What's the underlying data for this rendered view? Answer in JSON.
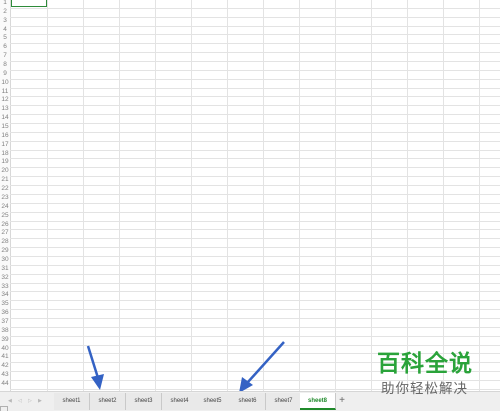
{
  "spreadsheet": {
    "row_numbers": [
      "1",
      "2",
      "3",
      "4",
      "5",
      "6",
      "7",
      "8",
      "9",
      "10",
      "11",
      "12",
      "13",
      "14",
      "15",
      "16",
      "17",
      "18",
      "19",
      "20",
      "21",
      "22",
      "23",
      "24",
      "25",
      "26",
      "27",
      "28",
      "29",
      "30",
      "31",
      "32",
      "33",
      "34",
      "35",
      "36",
      "37",
      "38",
      "39",
      "40",
      "41",
      "42",
      "43",
      "44"
    ]
  },
  "sheet_tabs": [
    {
      "label": "sheet1",
      "active": false
    },
    {
      "label": "sheet2",
      "active": false
    },
    {
      "label": "sheet3",
      "active": false
    },
    {
      "label": "sheet4",
      "active": false
    },
    {
      "label": "sheet5",
      "active": false
    },
    {
      "label": "sheet6",
      "active": false
    },
    {
      "label": "sheet7",
      "active": false
    },
    {
      "label": "sheet8",
      "active": true
    }
  ],
  "add_sheet": {
    "label": "+",
    "icon": "plus-icon"
  },
  "watermark": {
    "title": "百科全说",
    "subtitle": "助你轻松解决"
  },
  "colors": {
    "accent": "#1f8a2a",
    "arrow": "#3462c4",
    "watermark_green": "#2aa33a"
  }
}
